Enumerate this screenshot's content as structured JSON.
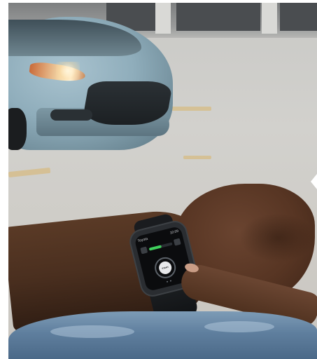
{
  "watch": {
    "app_name": "Toyota",
    "time": "10:09",
    "start_label": "START",
    "colors": {
      "accent_bar": "#3fd05c",
      "screen": "#0b0c0e",
      "button": "#e7e8ea"
    },
    "icons": [
      "lock-icon",
      "unlock-icon",
      "engine-start-icon"
    ]
  },
  "scene": {
    "car_color": "#8fadbb",
    "navigation_icon": "chevron-left-icon"
  }
}
